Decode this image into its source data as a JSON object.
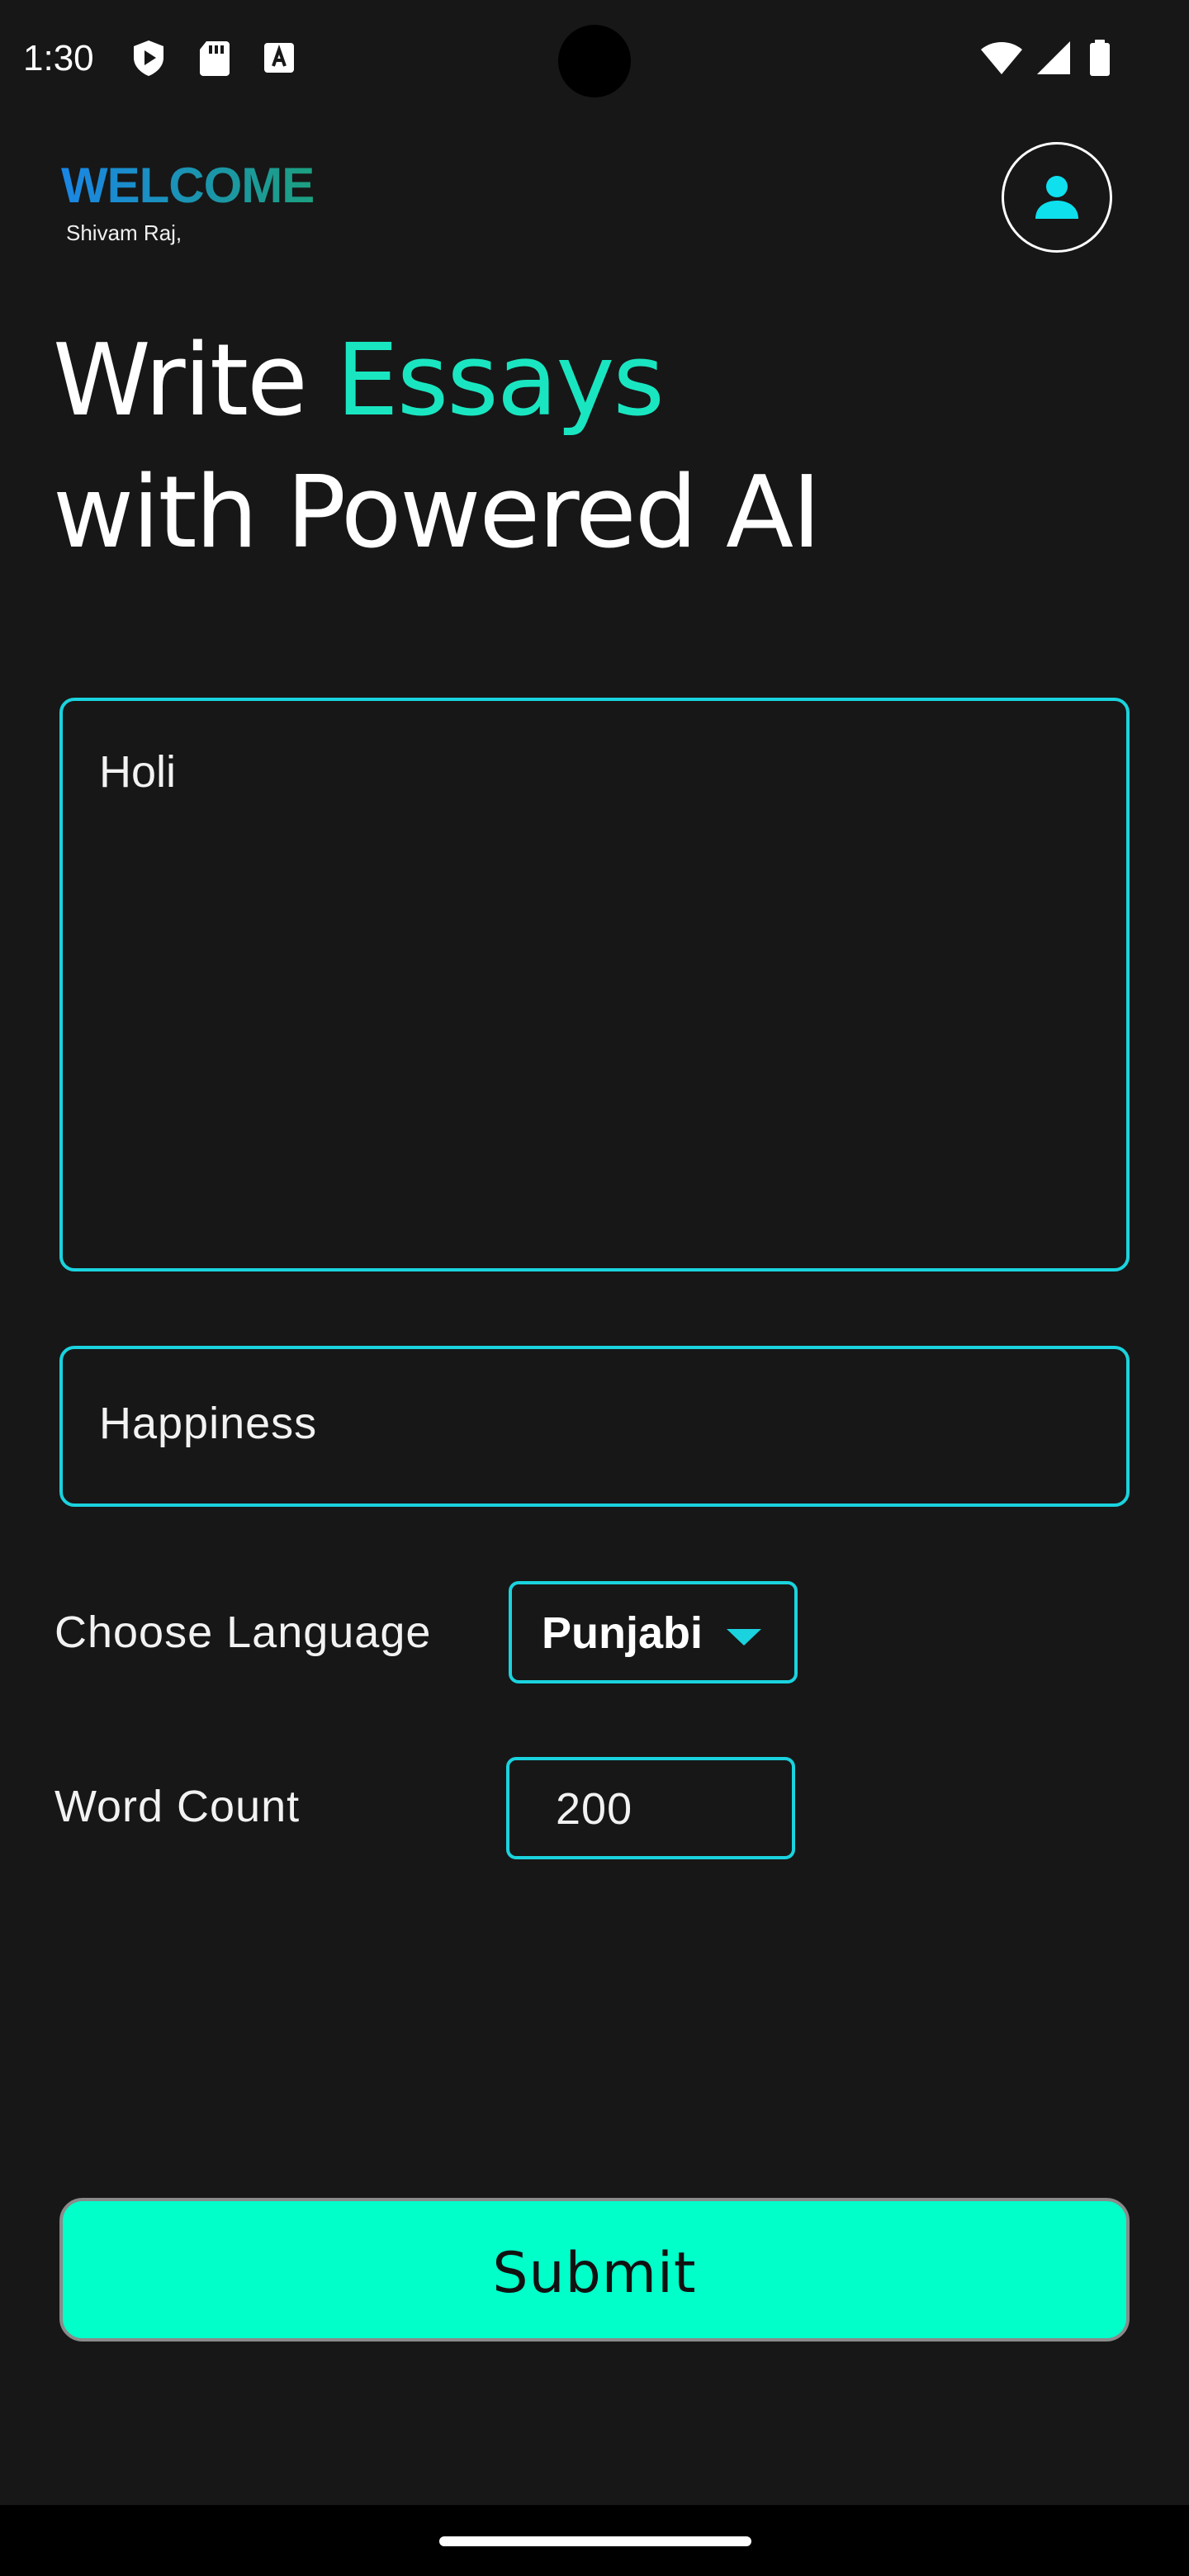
{
  "status_bar": {
    "time": "1:30",
    "left_icons": [
      "shield-play-icon",
      "sd-card-icon",
      "keyboard-a-icon"
    ],
    "right_icons": [
      "wifi-icon",
      "cellular-signal-icon",
      "battery-icon"
    ]
  },
  "header": {
    "welcome": "WELCOME",
    "username": "Shivam Raj,",
    "avatar_icon": "person-icon"
  },
  "hero": {
    "line1_prefix": "Write ",
    "line1_accent": "Essays",
    "line2": "with Powered AI"
  },
  "form": {
    "topic_value": "Holi",
    "keyword_value": "Happiness",
    "language_label": "Choose Language",
    "language_value": "Punjabi",
    "word_count_label": "Word Count",
    "word_count_value": "200",
    "submit_label": "Submit"
  },
  "colors": {
    "background": "#171717",
    "accent": "#19e6c1",
    "border": "#1ad3de",
    "submit": "#00ffc9",
    "welcome_gradient_start": "#1a86e6",
    "welcome_gradient_end": "#1ca07f"
  }
}
